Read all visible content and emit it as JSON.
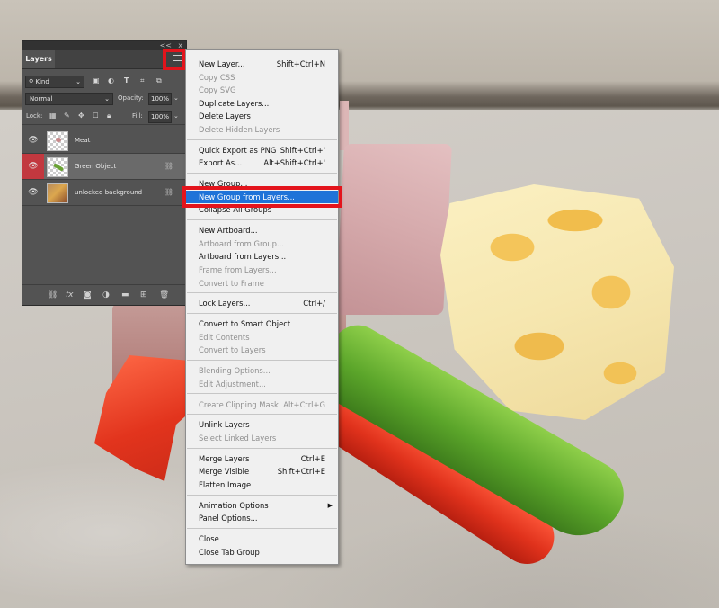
{
  "panel": {
    "tab_label": "Layers",
    "top_controls": [
      "<<",
      "x"
    ],
    "filter_kind": "Kind",
    "blend_mode": "Normal",
    "opacity_label": "Opacity:",
    "opacity_value": "100%",
    "lock_label": "Lock:",
    "fill_label": "Fill:",
    "fill_value": "100%",
    "layers": [
      {
        "name": "Meat",
        "selected": false,
        "thumbnail": "transparent-checker"
      },
      {
        "name": "Green Object",
        "selected": true,
        "thumbnail": "transparent-checker"
      },
      {
        "name": "unlocked background",
        "selected": false,
        "thumbnail": "photo"
      }
    ],
    "filter_icons": [
      "image-icon",
      "adjustment-icon",
      "type-icon",
      "shape-icon",
      "smart-object-icon"
    ],
    "lock_icons": [
      "lock-transparent-icon",
      "lock-paint-icon",
      "lock-move-icon",
      "artboard-icon",
      "lock-all-icon"
    ],
    "bottom_icons": [
      "link-icon",
      "fx-icon",
      "mask-icon",
      "adjustment-layer-icon",
      "group-icon",
      "new-layer-icon",
      "trash-icon"
    ]
  },
  "menu": {
    "groups": [
      [
        {
          "label": "New Layer...",
          "shortcut": "Shift+Ctrl+N",
          "enabled": true
        },
        {
          "label": "Copy CSS",
          "shortcut": "",
          "enabled": false
        },
        {
          "label": "Copy SVG",
          "shortcut": "",
          "enabled": false
        },
        {
          "label": "Duplicate Layers...",
          "shortcut": "",
          "enabled": true
        },
        {
          "label": "Delete Layers",
          "shortcut": "",
          "enabled": true
        },
        {
          "label": "Delete Hidden Layers",
          "shortcut": "",
          "enabled": false
        }
      ],
      [
        {
          "label": "Quick Export as PNG",
          "shortcut": "Shift+Ctrl+'",
          "enabled": true
        },
        {
          "label": "Export As...",
          "shortcut": "Alt+Shift+Ctrl+'",
          "enabled": true
        }
      ],
      [
        {
          "label": "New Group...",
          "shortcut": "",
          "enabled": true
        },
        {
          "label": "New Group from Layers...",
          "shortcut": "",
          "enabled": true,
          "highlighted": true
        },
        {
          "label": "Collapse All Groups",
          "shortcut": "",
          "enabled": true
        }
      ],
      [
        {
          "label": "New Artboard...",
          "shortcut": "",
          "enabled": true
        },
        {
          "label": "Artboard from Group...",
          "shortcut": "",
          "enabled": false
        },
        {
          "label": "Artboard from Layers...",
          "shortcut": "",
          "enabled": true
        },
        {
          "label": "Frame from Layers...",
          "shortcut": "",
          "enabled": false
        },
        {
          "label": "Convert to Frame",
          "shortcut": "",
          "enabled": false
        }
      ],
      [
        {
          "label": "Lock Layers...",
          "shortcut": "Ctrl+/",
          "enabled": true
        }
      ],
      [
        {
          "label": "Convert to Smart Object",
          "shortcut": "",
          "enabled": true
        },
        {
          "label": "Edit Contents",
          "shortcut": "",
          "enabled": false
        },
        {
          "label": "Convert to Layers",
          "shortcut": "",
          "enabled": false
        }
      ],
      [
        {
          "label": "Blending Options...",
          "shortcut": "",
          "enabled": false
        },
        {
          "label": "Edit Adjustment...",
          "shortcut": "",
          "enabled": false
        }
      ],
      [
        {
          "label": "Create Clipping Mask",
          "shortcut": "Alt+Ctrl+G",
          "enabled": false
        }
      ],
      [
        {
          "label": "Unlink Layers",
          "shortcut": "",
          "enabled": true
        },
        {
          "label": "Select Linked Layers",
          "shortcut": "",
          "enabled": false
        }
      ],
      [
        {
          "label": "Merge Layers",
          "shortcut": "Ctrl+E",
          "enabled": true
        },
        {
          "label": "Merge Visible",
          "shortcut": "Shift+Ctrl+E",
          "enabled": true
        },
        {
          "label": "Flatten Image",
          "shortcut": "",
          "enabled": true
        }
      ],
      [
        {
          "label": "Animation Options",
          "shortcut": "",
          "enabled": true,
          "submenu": true
        },
        {
          "label": "Panel Options...",
          "shortcut": "",
          "enabled": true
        }
      ],
      [
        {
          "label": "Close",
          "shortcut": "",
          "enabled": true
        },
        {
          "label": "Close Tab Group",
          "shortcut": "",
          "enabled": true
        }
      ]
    ]
  },
  "colors": {
    "highlight_box": "#e3141c",
    "menu_hover": "#1f73d8",
    "panel_bg": "#535353",
    "selected_layer_eye": "#c2383f"
  }
}
